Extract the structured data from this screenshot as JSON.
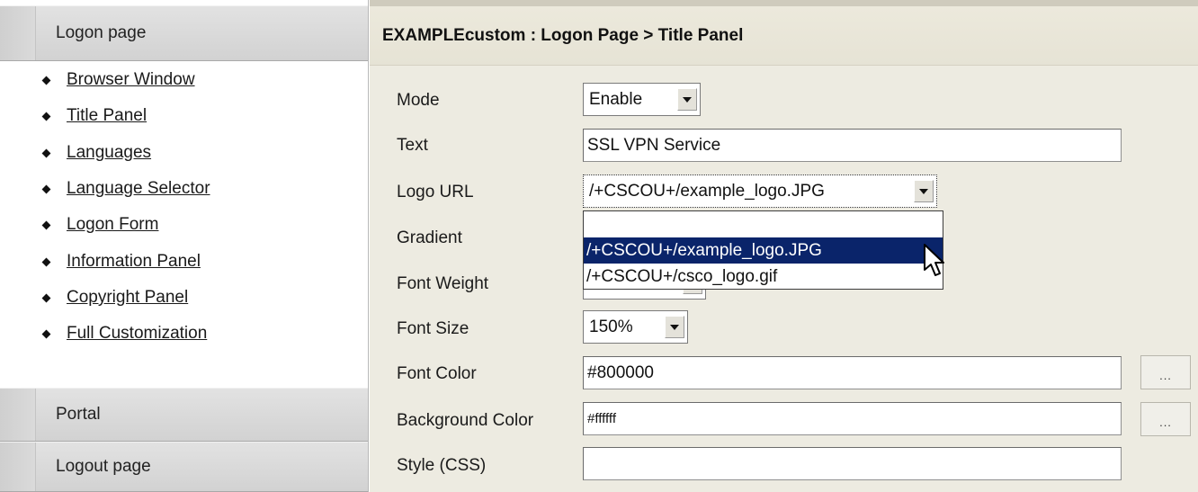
{
  "nav": {
    "sections": {
      "logon": "Logon page",
      "portal": "Portal",
      "logout": "Logout page"
    },
    "items": [
      "Browser Window",
      "Title Panel",
      "Languages",
      "Language Selector",
      "Logon Form",
      "Information Panel",
      "Copyright Panel",
      "Full Customization"
    ]
  },
  "panel": {
    "title": "EXAMPLEcustom : Logon Page > Title Panel"
  },
  "form": {
    "mode": {
      "label": "Mode",
      "value": "Enable"
    },
    "text": {
      "label": "Text",
      "value": "SSL VPN Service"
    },
    "logo_url": {
      "label": "Logo URL",
      "value": "/+CSCOU+/example_logo.JPG",
      "options": [
        "",
        "/+CSCOU+/example_logo.JPG",
        "/+CSCOU+/csco_logo.gif"
      ],
      "highlighted": "/+CSCOU+/example_logo.JPG"
    },
    "gradient": {
      "label": "Gradient"
    },
    "font_weight": {
      "label": "Font Weight"
    },
    "font_size": {
      "label": "Font Size",
      "value": "150%"
    },
    "font_color": {
      "label": "Font Color",
      "value": "#800000",
      "button": "..."
    },
    "background_color": {
      "label": "Background Color",
      "value": "#ffffff",
      "button": "..."
    },
    "style_css": {
      "label": "Style (CSS)",
      "value": ""
    }
  },
  "colors": {
    "selection_highlight": "#0a246a",
    "panel_background": "#edebe1",
    "section_header": "#d6d6d6"
  }
}
